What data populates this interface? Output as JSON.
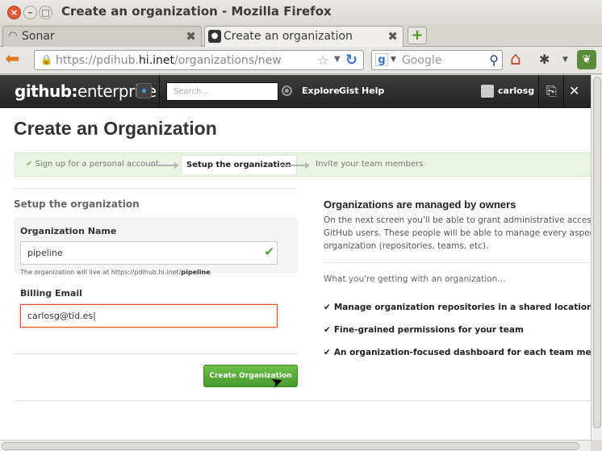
{
  "window": {
    "title": "Create an organization - Mozilla Firefox"
  },
  "tabs": [
    {
      "label": "Sonar"
    },
    {
      "label": "Create an organization"
    }
  ],
  "nav": {
    "url_prefix": "https://pdihub.",
    "url_host": "hi.inet",
    "url_path": "/organizations/new",
    "search_placeholder": "Google"
  },
  "gh": {
    "logo_bold": "github:",
    "logo_rest": "enterprise",
    "search_placeholder": "Search...",
    "nav": [
      "Explore",
      "Gist",
      "Help"
    ],
    "username": "carlosg"
  },
  "page": {
    "title": "Create an Organization",
    "steps": [
      "Sign up for a personal account",
      "Setup the organization",
      "Invite your team members"
    ],
    "section_heading": "Setup the organization",
    "org_name_label": "Organization Name",
    "org_name_value": "pipeline",
    "org_note_prefix": "The organization will live at https://pdihub.hi.inet/",
    "org_note_name": "pipeline",
    "billing_label": "Billing Email",
    "billing_value": "carlosg@tid.es",
    "create_button": "Create Organization"
  },
  "aside": {
    "title": "Organizations are managed by owners",
    "desc_lines": [
      "On the next screen you'll be able to grant administrative access to ot",
      "GitHub users. These people will be able to manage every aspect of t",
      "organization (repositories, teams, etc)."
    ],
    "subtitle": "What you're getting with an organization…",
    "features": [
      "Manage organization repositories in a shared location",
      "Fine-grained permissions for your team",
      "An organization-focused dashboard for each team member"
    ]
  }
}
